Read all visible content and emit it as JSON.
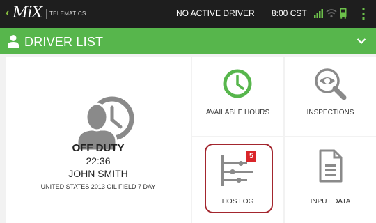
{
  "topbar": {
    "back_chevron": "‹",
    "logo_text": "MiX",
    "logo_subtitle": "TELEMATICS",
    "driver_status": "NO ACTIVE DRIVER",
    "clock": "8:00 CST",
    "icons": [
      "signal-icon",
      "wifi-icon",
      "vehicle-icon",
      "menu-icon"
    ],
    "accent_color": "#8cc63f"
  },
  "header": {
    "title": "DRIVER LIST",
    "background_color": "#57b64c"
  },
  "driver": {
    "status": "OFF DUTY",
    "time": "22:36",
    "name": "JOHN SMITH",
    "cycle": "UNITED STATES 2013 OIL FIELD 7 DAY"
  },
  "tiles": {
    "available_hours": "AVAILABLE HOURS",
    "inspections": "INSPECTIONS",
    "hos_log": "HOS LOG",
    "hos_log_badge": "5",
    "input_data": "INPUT DATA"
  },
  "colors": {
    "highlight": "#a3262e",
    "clock_icon": "#57b64c",
    "icon_gray": "#8a8a8a"
  }
}
